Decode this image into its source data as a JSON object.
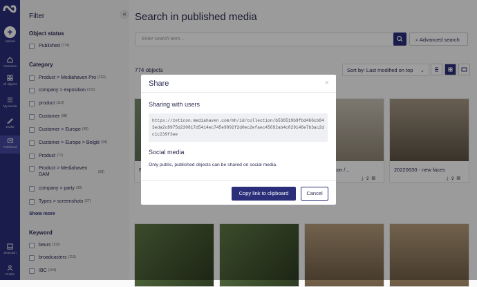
{
  "rail": {
    "items": [
      {
        "label": "Upload",
        "icon": "plus-icon"
      },
      {
        "label": "Overview",
        "icon": "home-icon"
      },
      {
        "label": "All objects",
        "icon": "grid-icon"
      },
      {
        "label": "My media",
        "icon": "list-icon"
      },
      {
        "label": "Drafts",
        "icon": "pencil-icon"
      },
      {
        "label": "Published",
        "icon": "publish-icon"
      },
      {
        "label": "Selection",
        "icon": "selection-icon"
      },
      {
        "label": "Profile",
        "icon": "person-icon"
      }
    ]
  },
  "filter": {
    "title": "Filter",
    "collapse_icon": "«",
    "object_status": {
      "heading": "Object status",
      "items": [
        {
          "label": "Published",
          "count": "(774)"
        }
      ]
    },
    "category": {
      "heading": "Category",
      "items": [
        {
          "label": "Product > Mediahaven Pro",
          "count": "(132)"
        },
        {
          "label": "company > exposition",
          "count": "(122)"
        },
        {
          "label": "product",
          "count": "(119)"
        },
        {
          "label": "Customer",
          "count": "(98)"
        },
        {
          "label": "Customer > Europe",
          "count": "(95)"
        },
        {
          "label": "Customer > Europe > België",
          "count": "(94)"
        },
        {
          "label": "Product",
          "count": "(77)"
        },
        {
          "label": "Product > Mediahaven DAM",
          "count": "(68)"
        },
        {
          "label": "company > party",
          "count": "(39)"
        },
        {
          "label": "Types > screenshots",
          "count": "(27)"
        }
      ],
      "show_more": "Show more"
    },
    "keyword": {
      "heading": "Keyword",
      "items": [
        {
          "label": "beurs",
          "count": "(115)"
        },
        {
          "label": "broadcasters",
          "count": "(113)"
        },
        {
          "label": "IBC",
          "count": "(104)"
        }
      ]
    }
  },
  "main": {
    "title": "Search in published media",
    "search_placeholder": "Enter search term...",
    "advanced_search": "Advanced search",
    "count": "774 objects",
    "sort": "Sort by: Last modified on top",
    "cards": [
      {
        "caption": "F"
      },
      {
        "caption": ""
      },
      {
        "caption": "ick-Off Zeticon /..."
      },
      {
        "caption": "20220630 - new faces"
      },
      {
        "caption": ""
      },
      {
        "caption": ""
      },
      {
        "caption": ""
      },
      {
        "caption": ""
      }
    ]
  },
  "modal": {
    "title": "Share",
    "close": "×",
    "sharing_heading": "Sharing with users",
    "url": "https://zeticon.mediahaven.com/mh/id/collection/b536519b9fbd466cb843eda2c8975d230817d5414ec745e9992f2d0ec2efaec45692ab4c029146e7b3ac2dc1c239f3ee",
    "social_heading": "Social media",
    "social_text": "Only public, published objects can be shared on social media.",
    "copy_button": "Copy link to clipboard",
    "cancel_button": "Cancel"
  },
  "colors": {
    "brand": "#2b2f7a",
    "accent": "#454aa0"
  }
}
